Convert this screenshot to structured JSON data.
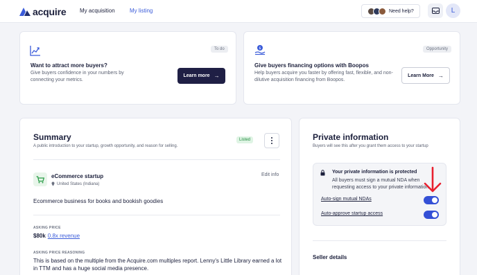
{
  "header": {
    "logo_text": "acquire",
    "nav": [
      "My acquisition",
      "My listing"
    ],
    "help_label": "Need help?",
    "user_initial": "L"
  },
  "promos": [
    {
      "tag": "To do",
      "title": "Want to attract more buyers?",
      "desc_line1": "Give buyers confidence in your numbers by",
      "desc_line2": "connecting your metrics.",
      "button": "Learn more",
      "icon": "chart-growth-icon"
    },
    {
      "tag": "Opportunity",
      "title": "Give buyers financing options with Boopos",
      "desc_line1": "Help buyers acquire you faster by offering fast, flexible, and non-",
      "desc_line2": "dilutive acquisition financing from Boopos.",
      "button": "Learn More",
      "icon": "money-hand-icon"
    }
  ],
  "summary": {
    "title": "Summary",
    "subtitle": "A public introduction to your startup, growth opportunity, and reason for selling.",
    "badge": "Listed",
    "business_name": "eCommerce startup",
    "location": "United States (Indiana)",
    "edit_label": "Edit info",
    "description": "Ecommerce business for books and bookish goodies",
    "asking_price_label": "ASKING PRICE",
    "asking_price": "$80k",
    "revenue_multiple": "0.8x revenue",
    "reasoning_label": "ASKING PRICE REASONING",
    "reasoning_line1": "This is based on the multiple from the Acquire.com multiples report. Lenny's Little Library earned a lot",
    "reasoning_line2": "in TTM and has a huge social media presence."
  },
  "private_info": {
    "title": "Private information",
    "subtitle": "Buyers will see this after you grant them access to your startup",
    "protected_title": "Your private information is protected",
    "protected_desc_line1": "All buyers must sign a mutual NDA when",
    "protected_desc_line2": "requesting access to your private information",
    "toggles": [
      {
        "label": "Auto-sign mutual NDAs",
        "on": true
      },
      {
        "label": "Auto-approve startup access",
        "on": true
      }
    ],
    "seller_details": "Seller details"
  },
  "colors": {
    "accent": "#3a5bd9",
    "toggle_on": "#3450d6",
    "dark_button": "#1f1f45",
    "annotation_arrow": "#e8202f"
  }
}
